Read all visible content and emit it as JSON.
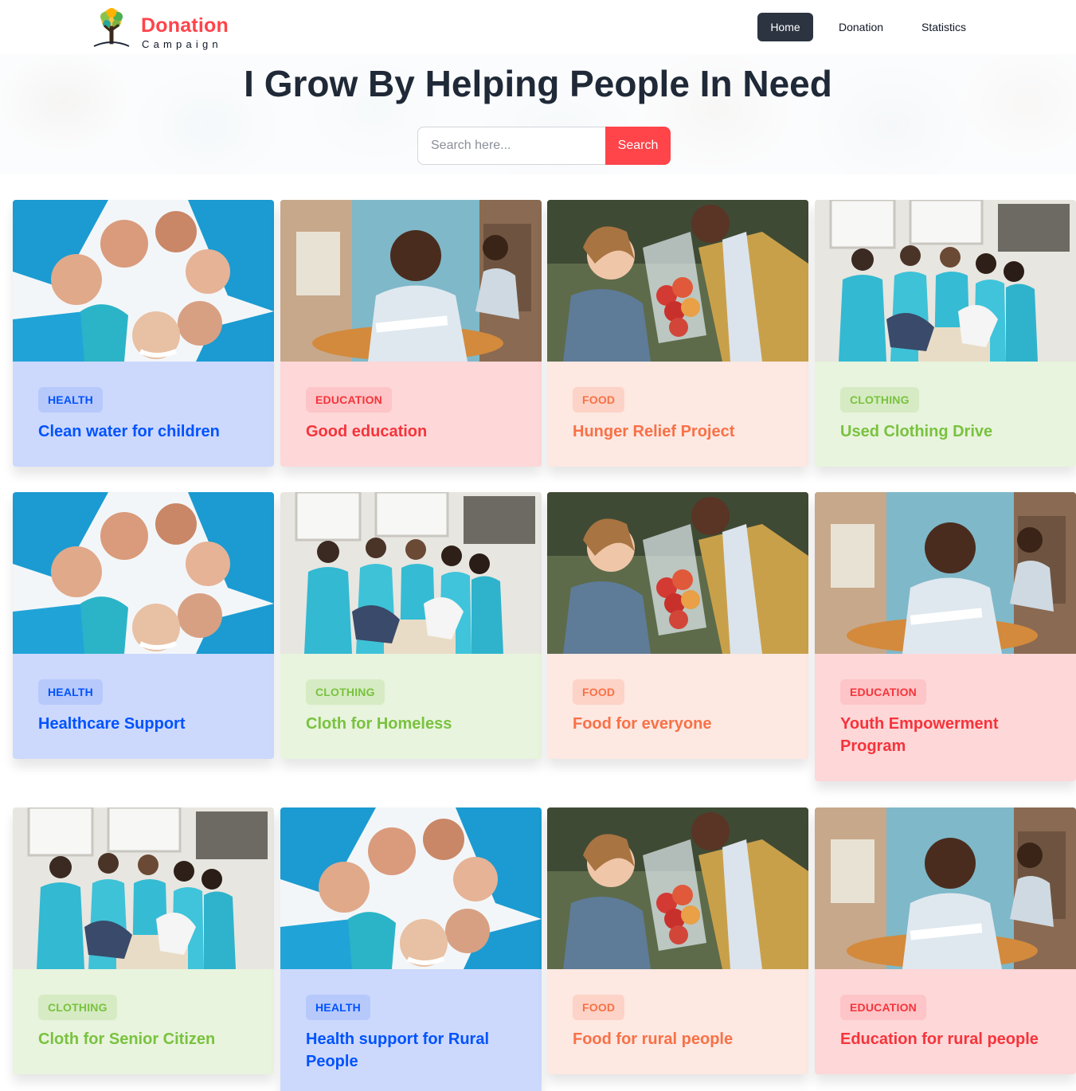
{
  "brand": {
    "title": "Donation",
    "subtitle": "Campaign"
  },
  "nav": {
    "items": [
      "Home",
      "Donation",
      "Statistics"
    ],
    "active": "Home"
  },
  "hero": {
    "title": "I Grow By Helping People In Need",
    "search_placeholder": "Search here...",
    "search_button": "Search"
  },
  "colors": {
    "brand": "#ff444a",
    "nav_active_bg": "#2b3440"
  },
  "category_styles": {
    "HEALTH": {
      "card_bg": "#ccd9fd",
      "badge_bg": "#b7c9fb",
      "text": "#0052ff"
    },
    "EDUCATION": {
      "card_bg": "#fed7d8",
      "badge_bg": "#fdc5c7",
      "text": "#f5343b"
    },
    "FOOD": {
      "card_bg": "#fde8e2",
      "badge_bg": "#fcd3c6",
      "text": "#f87147"
    },
    "CLOTHING": {
      "card_bg": "#e8f4dd",
      "badge_bg": "#d6ebc3",
      "text": "#79c23f"
    }
  },
  "cards": [
    {
      "category": "HEALTH",
      "title": "Clean water for children",
      "photo": "volunteers-circle-photo"
    },
    {
      "category": "EDUCATION",
      "title": "Good education",
      "photo": "student-desk-photo"
    },
    {
      "category": "FOOD",
      "title": "Hunger Relief Project",
      "photo": "girl-apples-photo"
    },
    {
      "category": "CLOTHING",
      "title": "Used Clothing Drive",
      "photo": "clothing-volunteers-photo"
    },
    {
      "category": "HEALTH",
      "title": "Healthcare Support",
      "photo": "volunteers-circle-photo"
    },
    {
      "category": "CLOTHING",
      "title": "Cloth for Homeless",
      "photo": "clothing-volunteers-photo"
    },
    {
      "category": "FOOD",
      "title": "Food for everyone",
      "photo": "girl-apples-photo"
    },
    {
      "category": "EDUCATION",
      "title": "Youth Empowerment Program",
      "photo": "student-desk-photo"
    },
    {
      "category": "CLOTHING",
      "title": "Cloth for Senior Citizen",
      "photo": "clothing-volunteers-photo"
    },
    {
      "category": "HEALTH",
      "title": "Health support for Rural People",
      "photo": "volunteers-circle-photo"
    },
    {
      "category": "FOOD",
      "title": "Food for rural people",
      "photo": "girl-apples-photo"
    },
    {
      "category": "EDUCATION",
      "title": "Education for rural people",
      "photo": "student-desk-photo"
    }
  ]
}
